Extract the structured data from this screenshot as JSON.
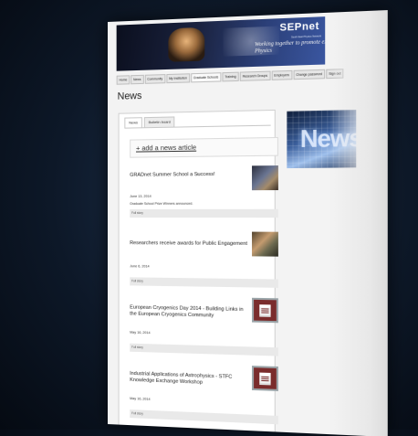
{
  "banner": {
    "tagline": "Working together to promote excellence in Physics",
    "logo": "SEPnet",
    "logo_sub": "South East Physics Network"
  },
  "nav": [
    "Home",
    "News",
    "Community",
    "My Institution",
    "Graduate Schools",
    "Training",
    "Research Groups",
    "Employers",
    "Change password",
    "Sign out"
  ],
  "page_title": "News",
  "tabs": [
    "News",
    "Bulletin board"
  ],
  "add_article": "+ add a news article",
  "articles": [
    {
      "title": "GRADnet Summer School a Success!",
      "date": "June 13, 2014",
      "summary": "Graduate School Prize Winners announced.",
      "more": "Full story"
    },
    {
      "title": "Researchers receive awards for Public Engagement",
      "date": "June 6, 2014",
      "summary": "",
      "more": "Full story"
    },
    {
      "title": "European Cryogenics Day 2014 - Building Links in the European Cryogenics Community",
      "date": "May 16, 2014",
      "summary": "",
      "more": "Full story"
    },
    {
      "title": "Industrial Applications of Astrophysics - STFC Knowledge Exchange Workshop",
      "date": "May 16, 2014",
      "summary": "",
      "more": "Full story"
    }
  ],
  "side_image_text": "News"
}
